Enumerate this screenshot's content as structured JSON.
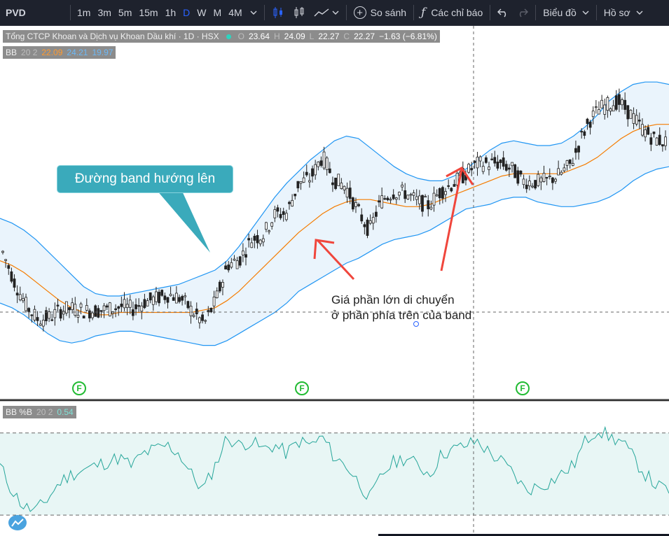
{
  "toolbar": {
    "symbol": "PVD",
    "intervals": [
      "1m",
      "3m",
      "5m",
      "15m",
      "1h",
      "D",
      "W",
      "M",
      "4M"
    ],
    "active_interval": "D",
    "compare_label": "So sánh",
    "indicators_label": "Các chỉ báo",
    "chart_label": "Biểu đồ",
    "profile_label": "Hồ sơ"
  },
  "legend": {
    "title": "Tổng CTCP Khoan và Dịch vụ Khoan Dầu khí · 1D · HSX",
    "open": "23.64",
    "high": "24.09",
    "low": "22.27",
    "close": "22.27",
    "change": "−1.63 (−6.81%)",
    "bb_name": "BB",
    "bb_params": "20 2",
    "bb_mid": "22.09",
    "bb_upper": "24.21",
    "bb_lower": "19.97"
  },
  "pctb_legend": {
    "name": "BB %B",
    "params": "20 2",
    "value": "0.54"
  },
  "annotations": {
    "callout": "Đường band hướng lên",
    "note_line1": "Giá phần lớn di chuyển",
    "note_line2": "ở phần phía trên của band",
    "event_marker": "F"
  },
  "colors": {
    "upper_band": "#2196f3",
    "middle_band": "#f57c00",
    "band_fill": "#eaf4fc",
    "candle": "#222222",
    "arrow": "#f0463c",
    "pctb_line": "#26a69a",
    "pctb_fill": "#e8f6f5",
    "event": "#22bb33"
  },
  "chart_data": {
    "type": "candlestick",
    "upper_band": [
      21.8,
      21.6,
      21.3,
      20.9,
      20.4,
      19.9,
      19.4,
      18.9,
      18.6,
      18.5,
      18.5,
      18.6,
      18.7,
      18.8,
      18.9,
      19.0,
      19.2,
      19.4,
      19.6,
      20.0,
      20.6,
      21.3,
      22.0,
      22.7,
      23.3,
      23.8,
      24.3,
      24.7,
      25.1,
      25.3,
      25.2,
      24.8,
      24.4,
      24.0,
      23.7,
      23.5,
      23.4,
      23.4,
      23.6,
      23.9,
      24.3,
      24.7,
      25.0,
      25.1,
      25.0,
      24.9,
      24.9,
      25.0,
      25.3,
      25.7,
      26.2,
      26.8,
      27.2,
      27.5,
      27.6,
      27.6,
      27.5
    ],
    "middle_band": [
      20.0,
      19.8,
      19.5,
      19.1,
      18.7,
      18.3,
      18.0,
      17.8,
      17.7,
      17.7,
      17.8,
      17.8,
      17.8,
      17.8,
      17.8,
      17.8,
      17.8,
      17.9,
      18.0,
      18.3,
      18.7,
      19.2,
      19.7,
      20.2,
      20.7,
      21.2,
      21.6,
      22.0,
      22.3,
      22.5,
      22.6,
      22.6,
      22.5,
      22.4,
      22.3,
      22.3,
      22.4,
      22.6,
      22.8,
      23.0,
      23.2,
      23.4,
      23.6,
      23.7,
      23.7,
      23.7,
      23.7,
      23.7,
      23.9,
      24.1,
      24.4,
      24.8,
      25.2,
      25.5,
      25.7,
      25.8,
      25.8
    ],
    "lower_band": [
      18.2,
      18.0,
      17.7,
      17.3,
      16.9,
      16.6,
      16.5,
      16.6,
      16.8,
      16.9,
      17.0,
      17.0,
      16.9,
      16.8,
      16.7,
      16.6,
      16.5,
      16.4,
      16.4,
      16.6,
      16.9,
      17.2,
      17.5,
      17.8,
      18.2,
      18.7,
      19.0,
      19.3,
      19.6,
      19.9,
      20.1,
      20.4,
      20.7,
      20.9,
      21.0,
      21.1,
      21.3,
      21.6,
      21.9,
      22.2,
      22.3,
      22.4,
      22.6,
      22.7,
      22.7,
      22.5,
      22.4,
      22.3,
      22.3,
      22.4,
      22.5,
      22.7,
      23.0,
      23.4,
      23.7,
      23.9,
      24.0
    ],
    "pct_b": [
      0.6,
      0.3,
      0.1,
      0.05,
      0.2,
      0.4,
      0.5,
      0.55,
      0.6,
      0.65,
      0.7,
      0.6,
      0.75,
      0.8,
      0.85,
      0.75,
      0.5,
      0.3,
      0.6,
      0.95,
      0.85,
      0.9,
      0.8,
      0.85,
      0.75,
      0.9,
      0.85,
      0.95,
      0.7,
      0.6,
      0.4,
      0.2,
      0.5,
      0.65,
      0.7,
      0.6,
      0.5,
      0.75,
      0.8,
      0.85,
      0.9,
      0.75,
      0.65,
      0.5,
      0.3,
      0.35,
      0.4,
      0.5,
      0.6,
      0.9,
      1.05,
      0.95,
      0.9,
      0.7,
      0.5,
      0.35,
      0.3
    ],
    "ylim": [
      16.0,
      28.5
    ],
    "pct_b_ylim": [
      -0.05,
      1.1
    ],
    "pct_b_bands": [
      0.0,
      1.0
    ]
  }
}
